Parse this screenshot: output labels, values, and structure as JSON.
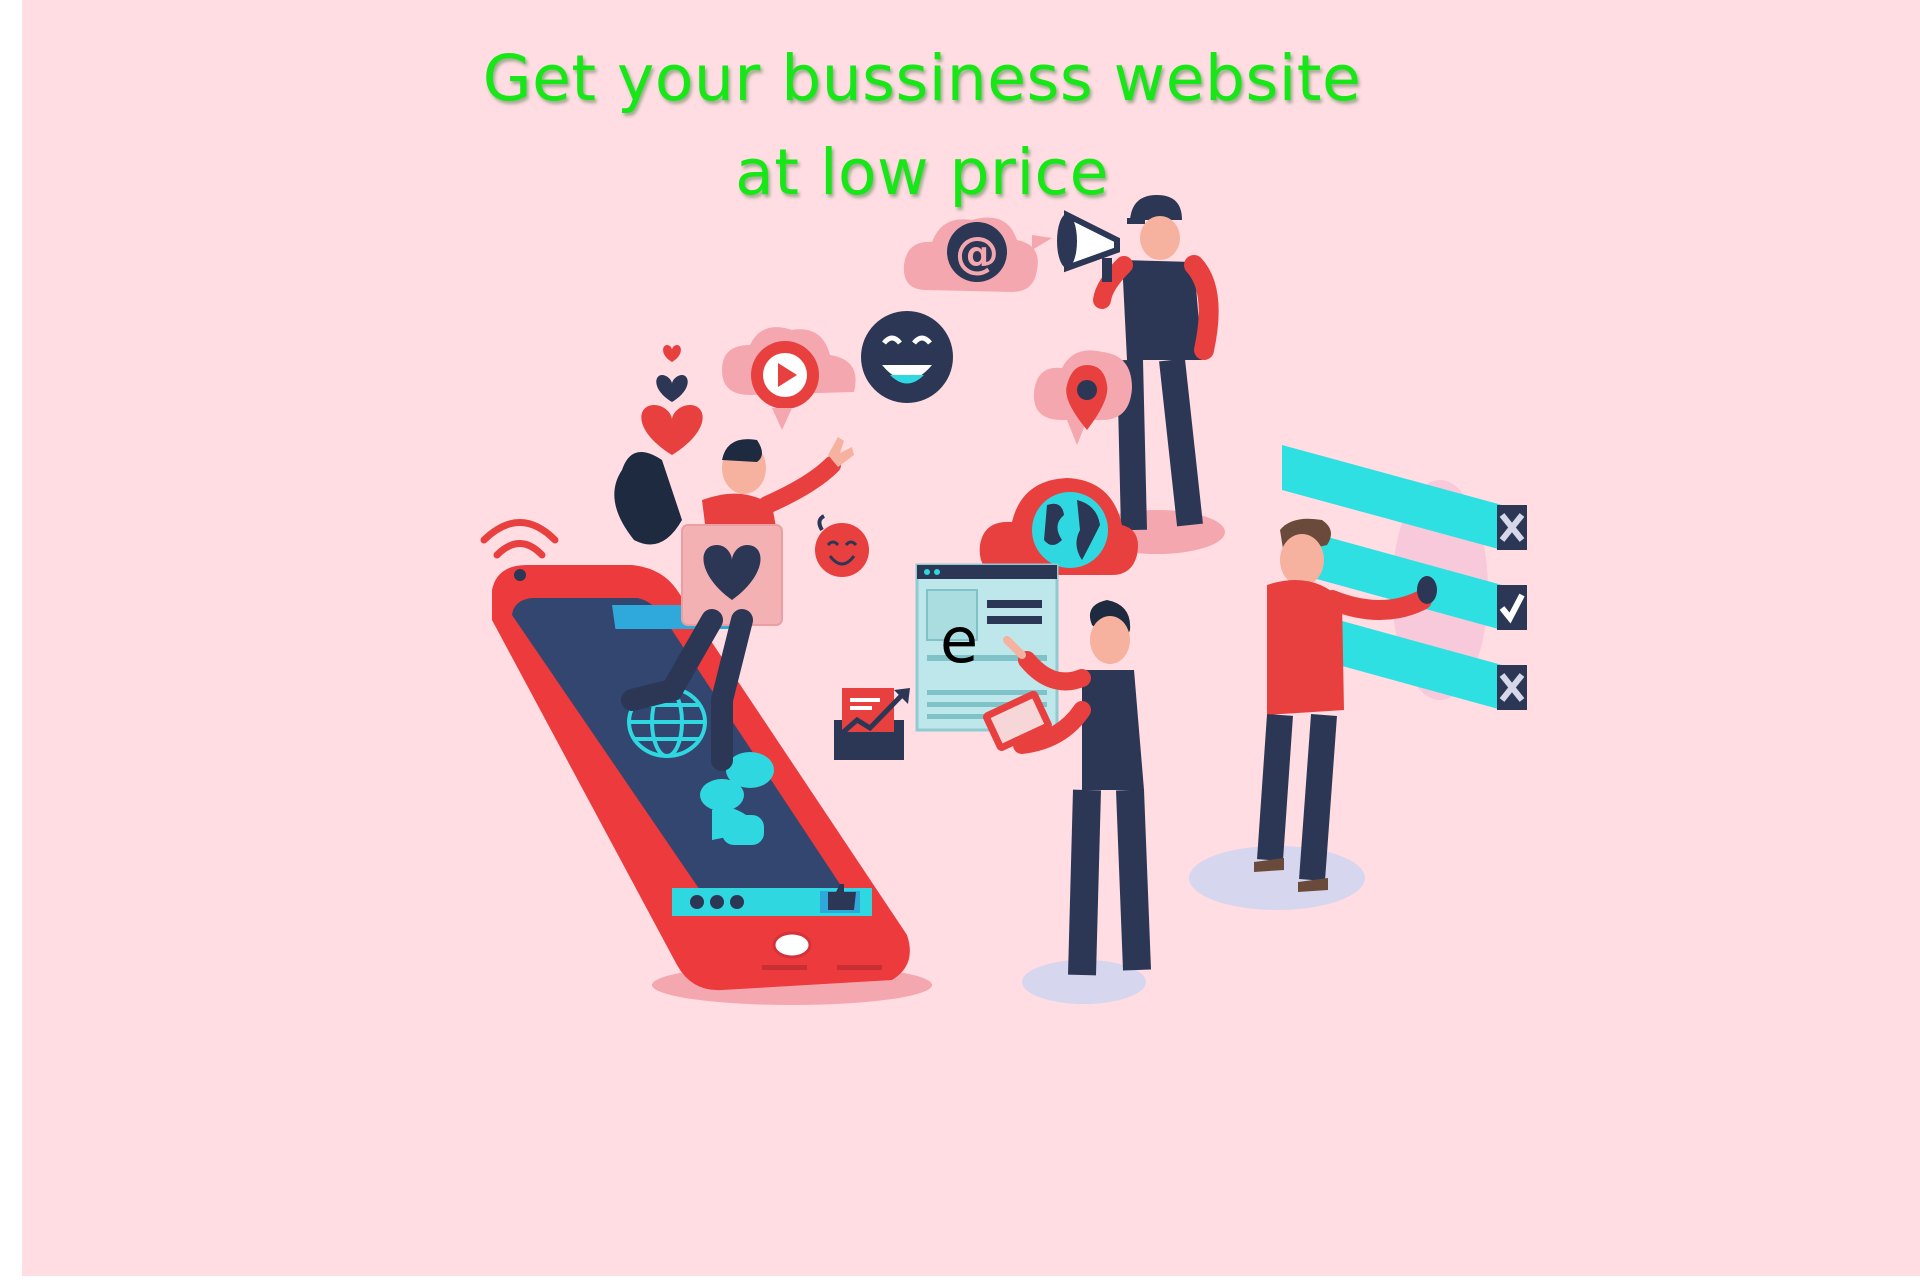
{
  "poster": {
    "headline_line1": "Get your bussiness website",
    "headline_line2": "at low price",
    "stray_letter": "e"
  },
  "colors": {
    "background": "#ffdde3",
    "headline": "#17e617",
    "accent_red": "#ec3a3d",
    "navy": "#2b3755",
    "cyan": "#2fe0e3"
  },
  "icons": [
    "at-sign-icon",
    "megaphone-icon",
    "smiley-face-icon",
    "play-icon",
    "heart-icon",
    "map-pin-icon",
    "globe-icon",
    "wifi-icon",
    "check-icon",
    "close-icon",
    "thumbs-up-icon",
    "email-icon"
  ]
}
